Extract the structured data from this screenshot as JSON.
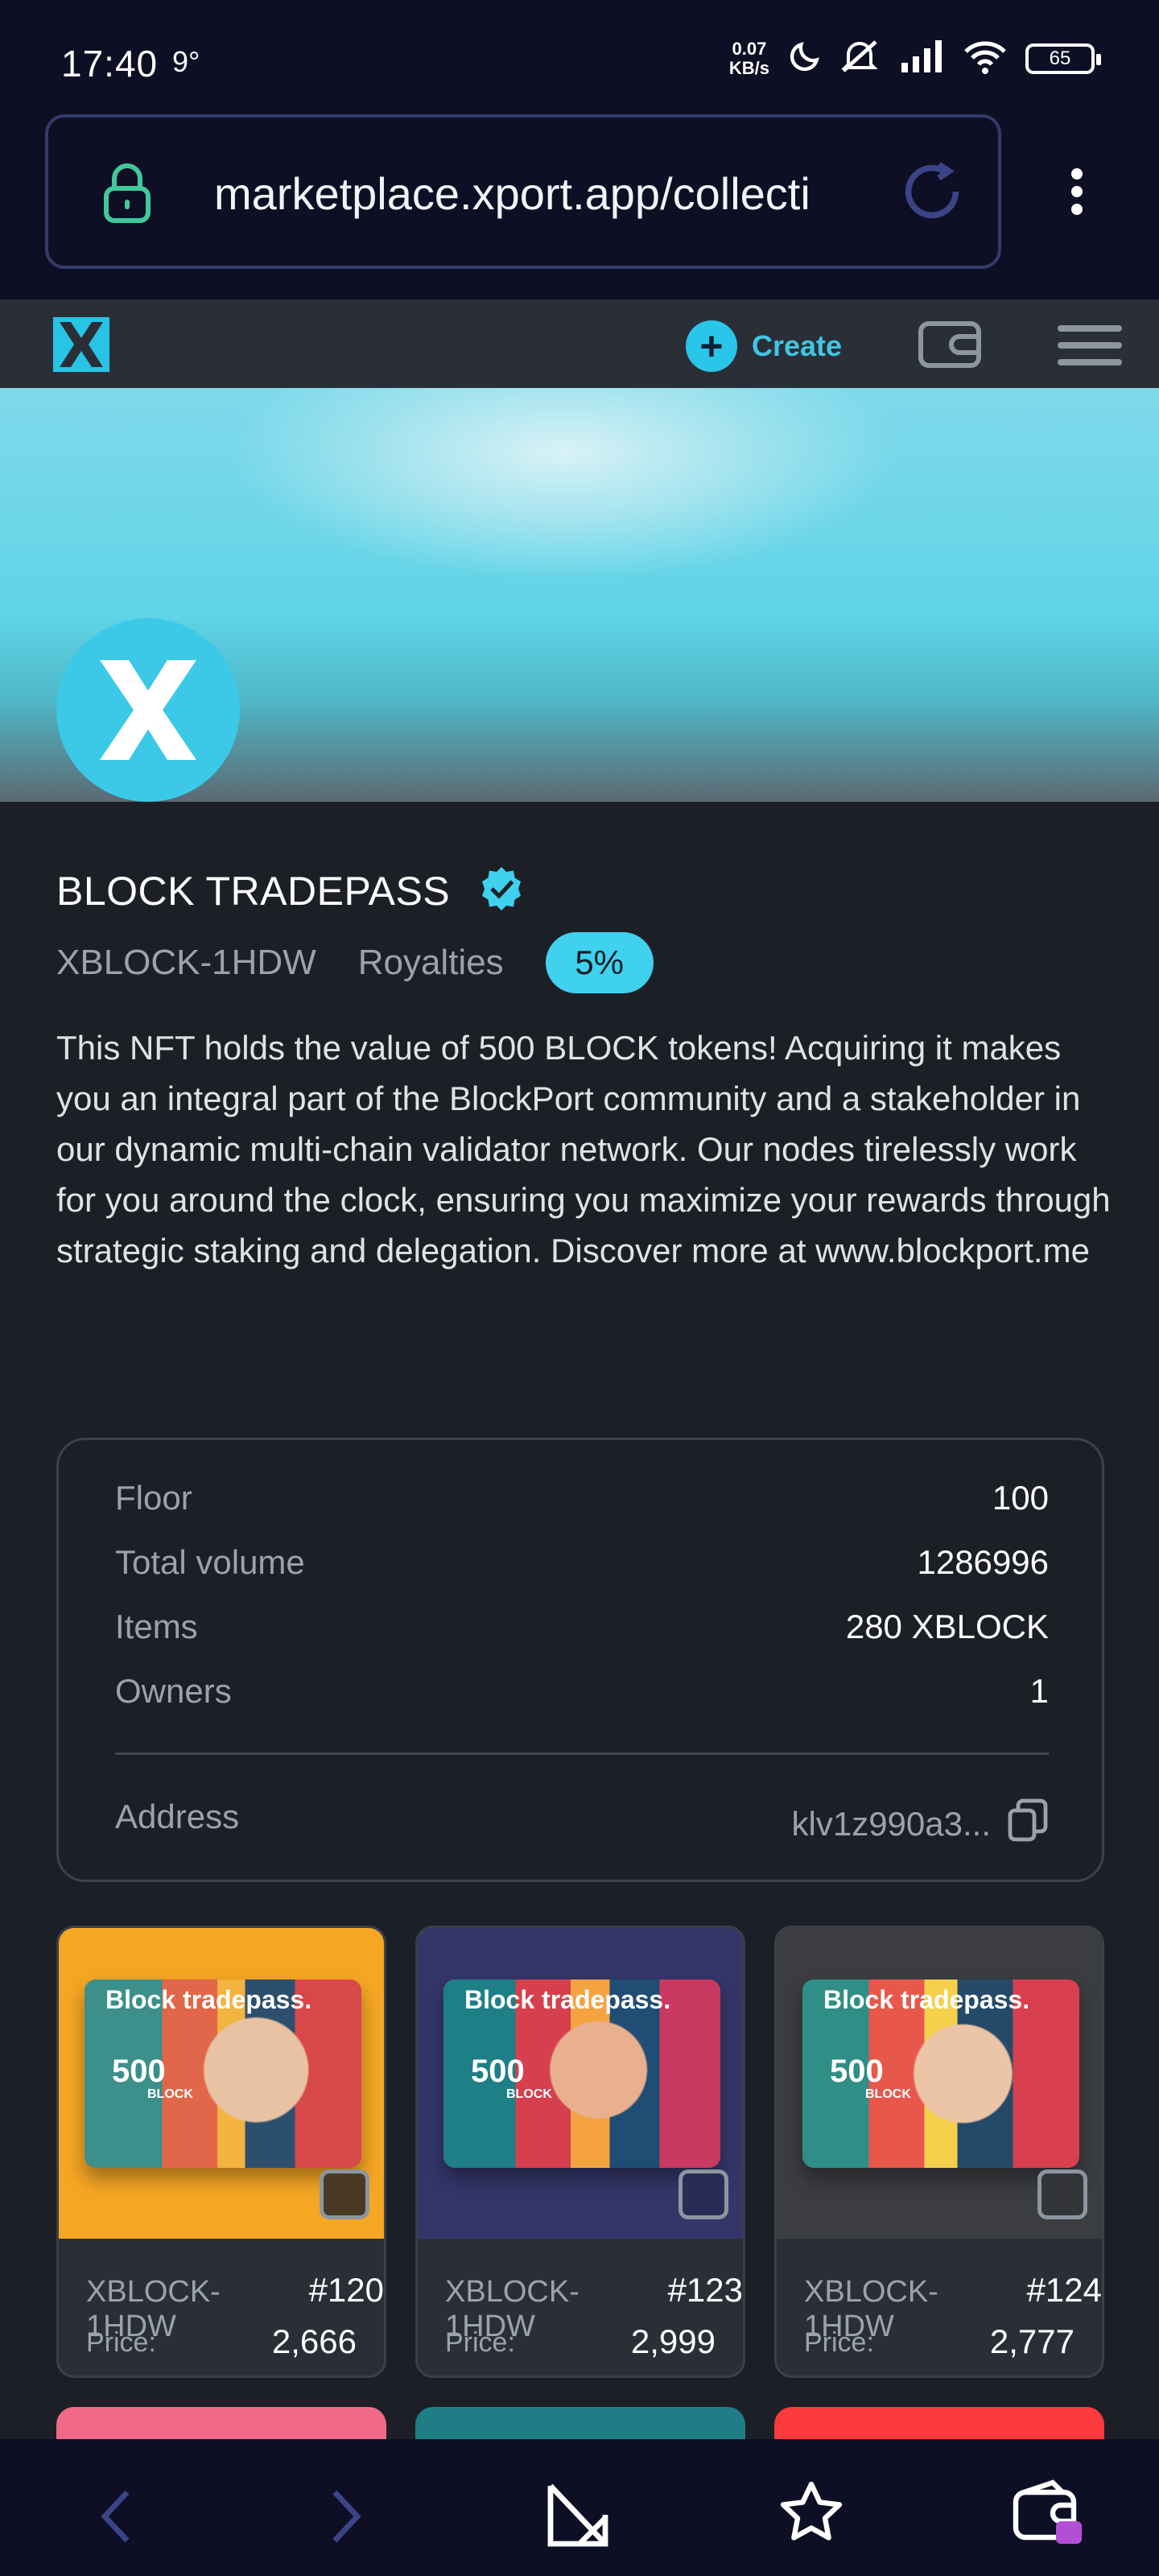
{
  "status_bar": {
    "time": "17:40",
    "temperature": "9°",
    "net_speed_value": "0.07",
    "net_speed_unit": "KB/s",
    "battery": "65"
  },
  "browser": {
    "url": "marketplace.xport.app/collecti"
  },
  "site_header": {
    "create_label": "Create",
    "accent_color": "#29c6ea"
  },
  "collection": {
    "title": "BLOCK TRADEPASS",
    "ticker": "XBLOCK-1HDW",
    "royalties_label": "Royalties",
    "royalties_value": "5%",
    "description": "This NFT holds the value of 500 BLOCK tokens! Acquiring it makes you an integral part of the BlockPort community and a stakeholder in our dynamic multi-chain validator network. Our nodes tirelessly work for you around the clock, ensuring you maximize your rewards through strategic staking and delegation. Discover more at www.blockport.me"
  },
  "stats": {
    "floor_label": "Floor",
    "floor_value": "100",
    "volume_label": "Total volume",
    "volume_value": "1286996",
    "items_label": "Items",
    "items_value": "280 XBLOCK",
    "owners_label": "Owners",
    "owners_value": "1",
    "address_label": "Address",
    "address_value": "klv1z990a3..."
  },
  "cards": [
    {
      "collection": "XBLOCK-1HDW",
      "number": "#120",
      "price_label": "Price:",
      "price": "2,666",
      "bg_color": "#f5a623",
      "art_title": "Block tradepass.",
      "art_amount": "500",
      "art_token": "BLOCK"
    },
    {
      "collection": "XBLOCK-1HDW",
      "number": "#123",
      "price_label": "Price:",
      "price": "2,999",
      "bg_color": "#34366a",
      "art_title": "Block tradepass.",
      "art_amount": "500",
      "art_token": "BLOCK"
    },
    {
      "collection": "XBLOCK-1HDW",
      "number": "#124",
      "price_label": "Price:",
      "price": "2,777",
      "bg_color": "#3b3d40",
      "art_title": "Block tradepass.",
      "art_amount": "500",
      "art_token": "BLOCK"
    }
  ],
  "next_row_colors": [
    "#f06a88",
    "#1e7d85",
    "#fb3a3e"
  ]
}
